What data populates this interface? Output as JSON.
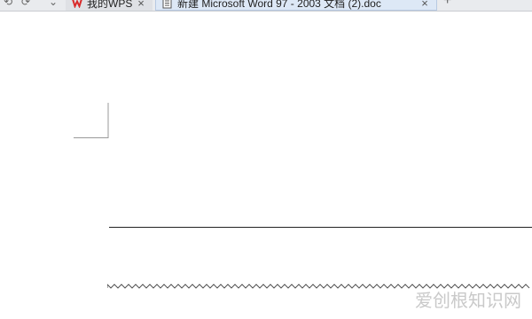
{
  "tabbar": {
    "back_icon": "back-icon",
    "forward_icon": "forward-icon",
    "tabs": [
      {
        "label": "我的WPS",
        "icon": "wps-logo-icon",
        "close": "×"
      },
      {
        "label": "新建 Microsoft Word 97 - 2003 文档 (2).doc",
        "icon": "document-icon",
        "close": "×"
      }
    ],
    "new_tab": "+"
  },
  "document": {
    "watermark": "爱创根知识网"
  },
  "colors": {
    "tabbar_bg": "#e9ebee",
    "active_tab_bg": "#dde8f6",
    "wps_red": "#d92b2b"
  }
}
